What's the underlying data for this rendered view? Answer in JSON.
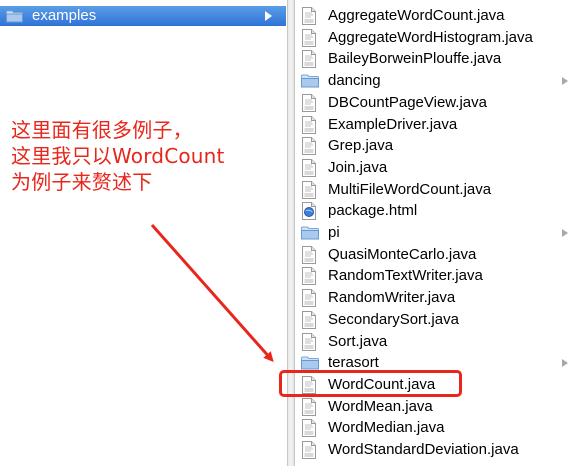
{
  "sidebar": {
    "selected_folder": {
      "label": "examples",
      "icon": "folder-icon"
    }
  },
  "annotation": {
    "lines": [
      "这里面有很多例子，",
      "这里我只以WordCount",
      "为例子来赘述下"
    ],
    "color": "#e8261b"
  },
  "files": [
    {
      "name": "AggregateWordCount.java",
      "type": "java",
      "icon": "java-file-icon",
      "has_arrow": false
    },
    {
      "name": "AggregateWordHistogram.java",
      "type": "java",
      "icon": "java-file-icon",
      "has_arrow": false
    },
    {
      "name": "BaileyBorweinPlouffe.java",
      "type": "java",
      "icon": "java-file-icon",
      "has_arrow": false
    },
    {
      "name": "dancing",
      "type": "folder",
      "icon": "folder-icon",
      "has_arrow": true
    },
    {
      "name": "DBCountPageView.java",
      "type": "java",
      "icon": "java-file-icon",
      "has_arrow": false
    },
    {
      "name": "ExampleDriver.java",
      "type": "java",
      "icon": "java-file-icon",
      "has_arrow": false
    },
    {
      "name": "Grep.java",
      "type": "java",
      "icon": "java-file-icon",
      "has_arrow": false
    },
    {
      "name": "Join.java",
      "type": "java",
      "icon": "java-file-icon",
      "has_arrow": false
    },
    {
      "name": "MultiFileWordCount.java",
      "type": "java",
      "icon": "java-file-icon",
      "has_arrow": false
    },
    {
      "name": "package.html",
      "type": "html",
      "icon": "html-file-icon",
      "has_arrow": false
    },
    {
      "name": "pi",
      "type": "folder",
      "icon": "folder-icon",
      "has_arrow": true
    },
    {
      "name": "QuasiMonteCarlo.java",
      "type": "java",
      "icon": "java-file-icon",
      "has_arrow": false
    },
    {
      "name": "RandomTextWriter.java",
      "type": "java",
      "icon": "java-file-icon",
      "has_arrow": false
    },
    {
      "name": "RandomWriter.java",
      "type": "java",
      "icon": "java-file-icon",
      "has_arrow": false
    },
    {
      "name": "SecondarySort.java",
      "type": "java",
      "icon": "java-file-icon",
      "has_arrow": false
    },
    {
      "name": "Sort.java",
      "type": "java",
      "icon": "java-file-icon",
      "has_arrow": false
    },
    {
      "name": "terasort",
      "type": "folder",
      "icon": "folder-icon",
      "has_arrow": true
    },
    {
      "name": "WordCount.java",
      "type": "java",
      "icon": "java-file-icon",
      "has_arrow": false,
      "highlighted": true
    },
    {
      "name": "WordMean.java",
      "type": "java",
      "icon": "java-file-icon",
      "has_arrow": false
    },
    {
      "name": "WordMedian.java",
      "type": "java",
      "icon": "java-file-icon",
      "has_arrow": false
    },
    {
      "name": "WordStandardDeviation.java",
      "type": "java",
      "icon": "java-file-icon",
      "has_arrow": false
    }
  ]
}
